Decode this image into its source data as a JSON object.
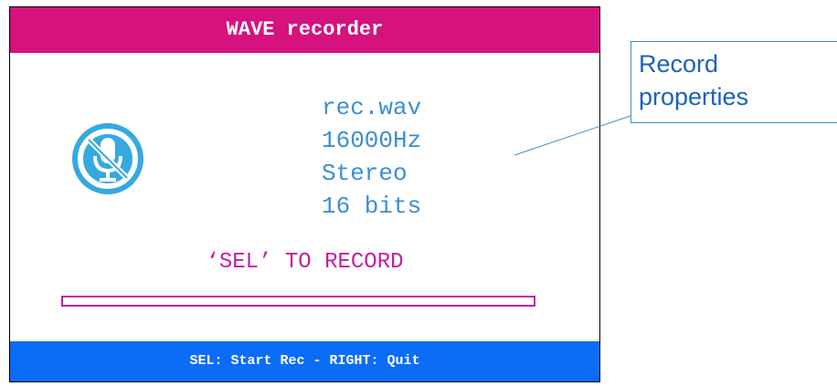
{
  "recorder": {
    "title": "WAVE recorder",
    "icon": "microphone-muted-icon",
    "file_name": "rec.wav",
    "sample_rate": "16000Hz",
    "channels": "Stereo",
    "bit_depth": "16 bits",
    "prompt": "‘SEL’ TO RECORD",
    "progress": 0,
    "status_bar": "SEL: Start Rec - RIGHT: Quit"
  },
  "callout": {
    "line1": "Record",
    "line2": "properties"
  },
  "colors": {
    "title_bar": "#d5127e",
    "status_bar": "#0b6cf5",
    "info_text": "#3f8ed1",
    "prompt_text": "#c21fa0",
    "icon": "#35a9e0",
    "callout_text": "#1b62b8"
  }
}
